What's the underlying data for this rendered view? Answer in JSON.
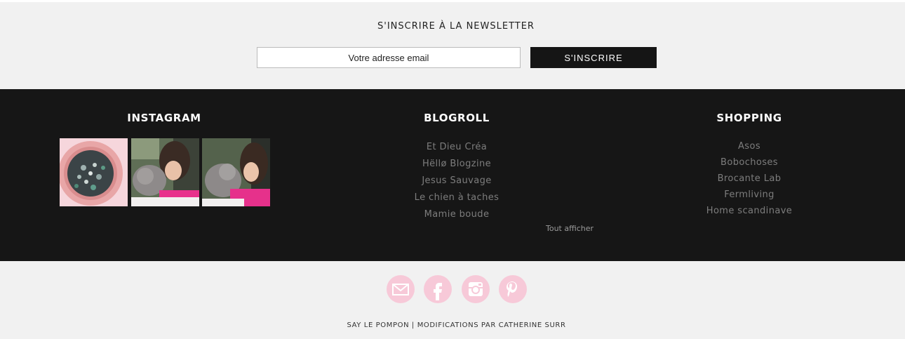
{
  "newsletter": {
    "title": "S'INSCRIRE À LA NEWSLETTER",
    "email_placeholder": "Votre adresse email",
    "subscribe_label": "S'INSCRIRE"
  },
  "instagram": {
    "title": "INSTAGRAM"
  },
  "blogroll": {
    "title": "BLOGROLL",
    "items": [
      {
        "label": "Et Dieu Créa"
      },
      {
        "label": "Hëllø Blogzine"
      },
      {
        "label": "Jesus Sauvage"
      },
      {
        "label": "Le chien à taches"
      },
      {
        "label": "Mamie boude"
      }
    ],
    "show_all": "Tout afficher"
  },
  "shopping": {
    "title": "SHOPPING",
    "items": [
      {
        "label": "Asos"
      },
      {
        "label": "Bobochoses"
      },
      {
        "label": "Brocante Lab"
      },
      {
        "label": "Fermliving"
      },
      {
        "label": "Home scandinave"
      }
    ]
  },
  "social": {
    "icons": [
      "mail-icon",
      "facebook-icon",
      "instagram-icon",
      "pinterest-icon"
    ],
    "accent": "#f7c9d8"
  },
  "credits": {
    "site": "SAY LE POMPON",
    "separator": " | ",
    "mod": "MODIFICATIONS PAR CATHERINE SURR"
  },
  "colors": {
    "background_light": "#f1f1f1",
    "background_dark": "#161616",
    "link": "#7d7d7d"
  }
}
